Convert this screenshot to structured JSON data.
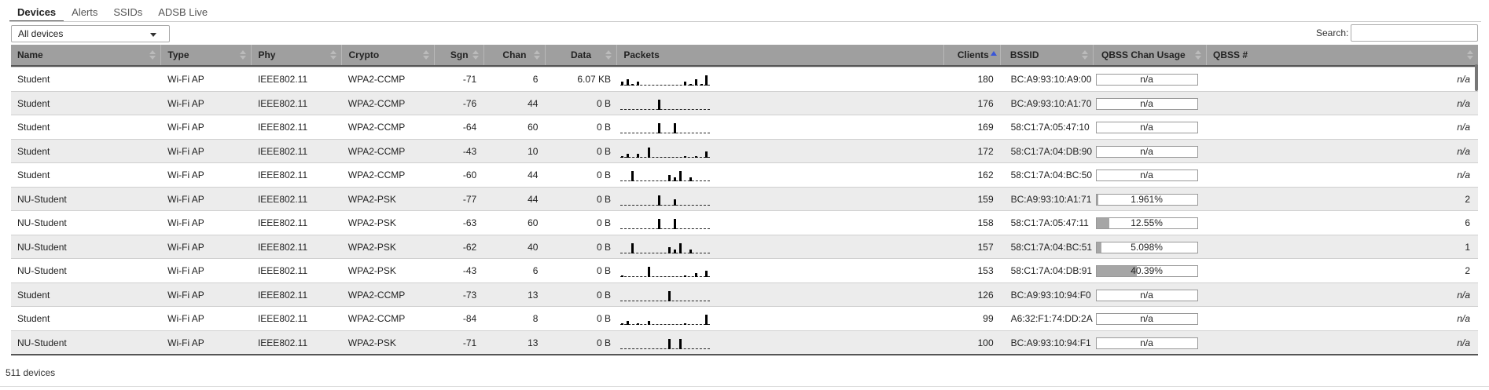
{
  "tabs": [
    {
      "label": "Devices",
      "active": true
    },
    {
      "label": "Alerts",
      "active": false
    },
    {
      "label": "SSIDs",
      "active": false
    },
    {
      "label": "ADSB Live",
      "active": false
    }
  ],
  "filter": {
    "selected": "All devices"
  },
  "search": {
    "label": "Search:",
    "value": ""
  },
  "columns": {
    "name": "Name",
    "type": "Type",
    "phy": "Phy",
    "crypto": "Crypto",
    "sgn": "Sgn",
    "chan": "Chan",
    "data": "Data",
    "packets": "Packets",
    "clients": "Clients",
    "bssid": "BSSID",
    "qbss_usage": "QBSS Chan Usage",
    "qbss_count": "QBSS #"
  },
  "sort": {
    "column": "clients",
    "direction": "ascending-indicator"
  },
  "rows": [
    {
      "name": "Student",
      "type": "Wi-Fi AP",
      "phy": "IEEE802.11",
      "crypto": "WPA2-CCMP",
      "sgn": "-71",
      "chan": "6",
      "data": "6.07 KB",
      "packets": [
        2,
        3,
        1,
        2,
        0,
        0,
        0,
        0,
        0,
        0,
        0,
        0,
        2,
        1,
        3,
        1,
        5
      ],
      "clients": "180",
      "bssid": "BC:A9:93:10:A9:00",
      "qbss_usage": "n/a",
      "qbss_fraction": 0,
      "qbss_count": "n/a"
    },
    {
      "name": "Student",
      "type": "Wi-Fi AP",
      "phy": "IEEE802.11",
      "crypto": "WPA2-CCMP",
      "sgn": "-76",
      "chan": "44",
      "data": "0 B",
      "packets": [
        0,
        0,
        0,
        0,
        0,
        0,
        0,
        5,
        0,
        0,
        0,
        0,
        0,
        0,
        0,
        0,
        0
      ],
      "clients": "176",
      "bssid": "BC:A9:93:10:A1:70",
      "qbss_usage": "n/a",
      "qbss_fraction": 0,
      "qbss_count": "n/a"
    },
    {
      "name": "Student",
      "type": "Wi-Fi AP",
      "phy": "IEEE802.11",
      "crypto": "WPA2-CCMP",
      "sgn": "-64",
      "chan": "60",
      "data": "0 B",
      "packets": [
        0,
        0,
        0,
        0,
        0,
        0,
        0,
        5,
        0,
        0,
        5,
        0,
        0,
        0,
        0,
        0,
        0
      ],
      "clients": "169",
      "bssid": "58:C1:7A:05:47:10",
      "qbss_usage": "n/a",
      "qbss_fraction": 0,
      "qbss_count": "n/a"
    },
    {
      "name": "Student",
      "type": "Wi-Fi AP",
      "phy": "IEEE802.11",
      "crypto": "WPA2-CCMP",
      "sgn": "-43",
      "chan": "10",
      "data": "0 B",
      "packets": [
        1,
        2,
        0,
        2,
        0,
        5,
        0,
        0,
        0,
        0,
        0,
        0,
        1,
        0,
        1,
        0,
        3
      ],
      "clients": "172",
      "bssid": "58:C1:7A:04:DB:90",
      "qbss_usage": "n/a",
      "qbss_fraction": 0,
      "qbss_count": "n/a"
    },
    {
      "name": "Student",
      "type": "Wi-Fi AP",
      "phy": "IEEE802.11",
      "crypto": "WPA2-CCMP",
      "sgn": "-60",
      "chan": "44",
      "data": "0 B",
      "packets": [
        0,
        0,
        5,
        0,
        0,
        0,
        0,
        0,
        0,
        3,
        2,
        5,
        0,
        2,
        0,
        0,
        0
      ],
      "clients": "162",
      "bssid": "58:C1:7A:04:BC:50",
      "qbss_usage": "n/a",
      "qbss_fraction": 0,
      "qbss_count": "n/a"
    },
    {
      "name": "NU-Student",
      "type": "Wi-Fi AP",
      "phy": "IEEE802.11",
      "crypto": "WPA2-PSK",
      "sgn": "-77",
      "chan": "44",
      "data": "0 B",
      "packets": [
        0,
        0,
        0,
        0,
        0,
        0,
        0,
        5,
        0,
        0,
        3,
        0,
        0,
        0,
        0,
        0,
        0
      ],
      "clients": "159",
      "bssid": "BC:A9:93:10:A1:71",
      "qbss_usage": "1.961%",
      "qbss_fraction": 0.01961,
      "qbss_count": "2"
    },
    {
      "name": "NU-Student",
      "type": "Wi-Fi AP",
      "phy": "IEEE802.11",
      "crypto": "WPA2-PSK",
      "sgn": "-63",
      "chan": "60",
      "data": "0 B",
      "packets": [
        0,
        0,
        0,
        0,
        0,
        0,
        0,
        5,
        0,
        0,
        5,
        0,
        0,
        0,
        0,
        0,
        0
      ],
      "clients": "158",
      "bssid": "58:C1:7A:05:47:11",
      "qbss_usage": "12.55%",
      "qbss_fraction": 0.1255,
      "qbss_count": "6"
    },
    {
      "name": "NU-Student",
      "type": "Wi-Fi AP",
      "phy": "IEEE802.11",
      "crypto": "WPA2-PSK",
      "sgn": "-62",
      "chan": "40",
      "data": "0 B",
      "packets": [
        0,
        0,
        5,
        0,
        0,
        0,
        0,
        0,
        0,
        3,
        2,
        5,
        0,
        2,
        0,
        0,
        0
      ],
      "clients": "157",
      "bssid": "58:C1:7A:04:BC:51",
      "qbss_usage": "5.098%",
      "qbss_fraction": 0.05098,
      "qbss_count": "1"
    },
    {
      "name": "NU-Student",
      "type": "Wi-Fi AP",
      "phy": "IEEE802.11",
      "crypto": "WPA2-PSK",
      "sgn": "-43",
      "chan": "6",
      "data": "0 B",
      "packets": [
        1,
        0,
        0,
        0,
        0,
        5,
        0,
        0,
        0,
        0,
        0,
        0,
        1,
        0,
        2,
        0,
        3
      ],
      "clients": "153",
      "bssid": "58:C1:7A:04:DB:91",
      "qbss_usage": "40.39%",
      "qbss_fraction": 0.4039,
      "qbss_count": "2"
    },
    {
      "name": "Student",
      "type": "Wi-Fi AP",
      "phy": "IEEE802.11",
      "crypto": "WPA2-CCMP",
      "sgn": "-73",
      "chan": "13",
      "data": "0 B",
      "packets": [
        0,
        0,
        0,
        0,
        0,
        0,
        0,
        0,
        0,
        5,
        0,
        0,
        0,
        0,
        0,
        0,
        0
      ],
      "clients": "126",
      "bssid": "BC:A9:93:10:94:F0",
      "qbss_usage": "n/a",
      "qbss_fraction": 0,
      "qbss_count": "n/a"
    },
    {
      "name": "Student",
      "type": "Wi-Fi AP",
      "phy": "IEEE802.11",
      "crypto": "WPA2-CCMP",
      "sgn": "-84",
      "chan": "8",
      "data": "0 B",
      "packets": [
        1,
        2,
        0,
        1,
        0,
        2,
        0,
        0,
        0,
        0,
        0,
        0,
        1,
        0,
        0,
        0,
        5
      ],
      "clients": "99",
      "bssid": "A6:32:F1:74:DD:2A",
      "qbss_usage": "n/a",
      "qbss_fraction": 0,
      "qbss_count": "n/a"
    },
    {
      "name": "NU-Student",
      "type": "Wi-Fi AP",
      "phy": "IEEE802.11",
      "crypto": "WPA2-PSK",
      "sgn": "-71",
      "chan": "13",
      "data": "0 B",
      "packets": [
        0,
        0,
        0,
        0,
        0,
        0,
        0,
        0,
        0,
        5,
        0,
        5,
        0,
        0,
        0,
        0,
        0
      ],
      "clients": "100",
      "bssid": "BC:A9:93:10:94:F1",
      "qbss_usage": "n/a",
      "qbss_fraction": 0,
      "qbss_count": "n/a"
    }
  ],
  "footer": {
    "count_text": "511 devices"
  }
}
